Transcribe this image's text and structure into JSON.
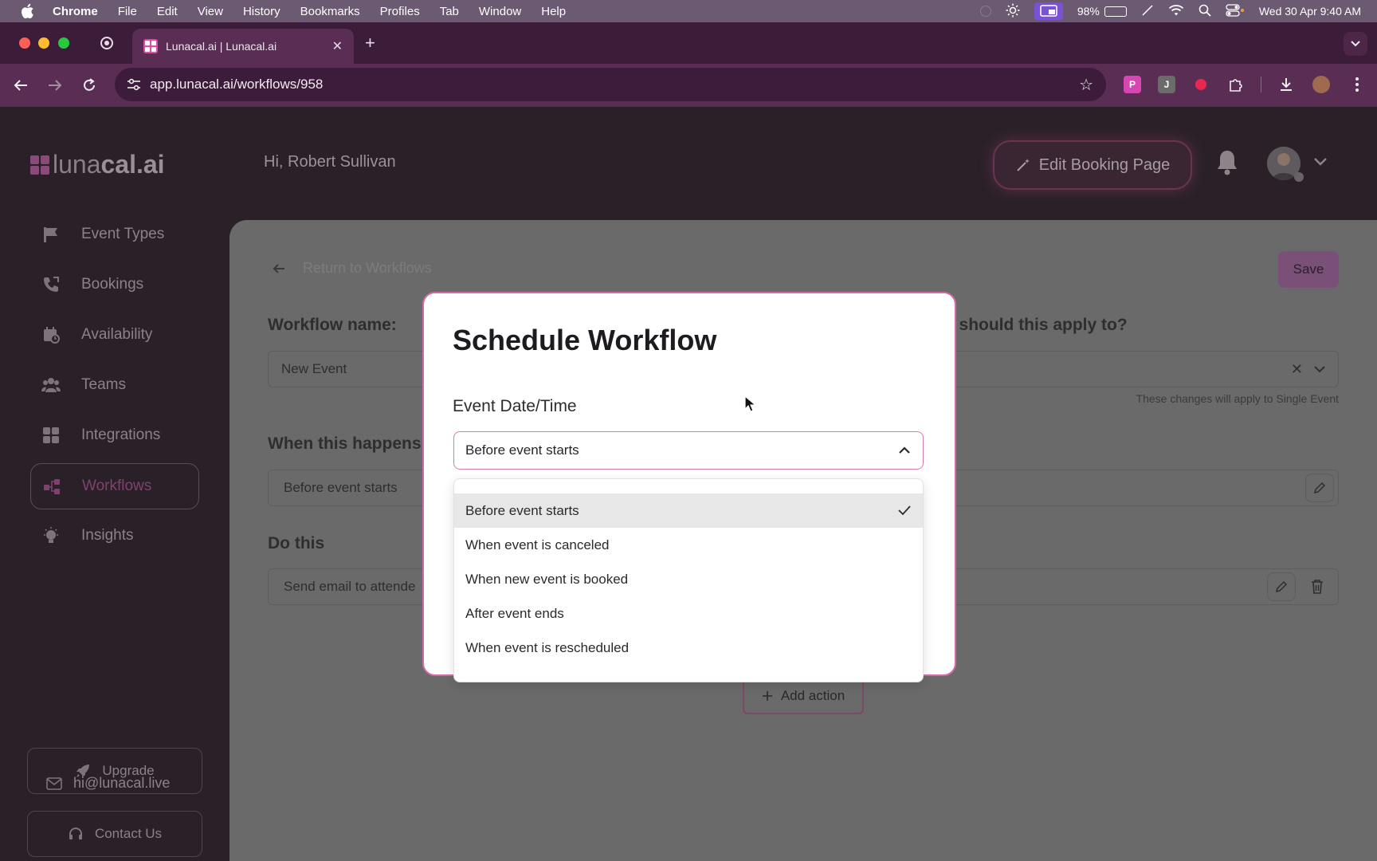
{
  "menubar": {
    "items": [
      "Chrome",
      "File",
      "Edit",
      "View",
      "History",
      "Bookmarks",
      "Profiles",
      "Tab",
      "Window",
      "Help"
    ],
    "battery": "98%",
    "battery_level": 0.98,
    "datetime": "Wed 30 Apr  9:40 AM"
  },
  "browser": {
    "tab_title": "Lunacal.ai | Lunacal.ai",
    "url": "app.lunacal.ai/workflows/958",
    "ext_j": "J"
  },
  "app": {
    "logo_light": "luna",
    "logo_bold": "cal.ai",
    "greeting": "Hi, Robert Sullivan",
    "edit_booking": "Edit Booking Page"
  },
  "sidebar": {
    "items": [
      {
        "label": "Event Types",
        "icon": "flag-icon"
      },
      {
        "label": "Bookings",
        "icon": "phone-icon"
      },
      {
        "label": "Availability",
        "icon": "calendar-clock-icon"
      },
      {
        "label": "Teams",
        "icon": "users-icon"
      },
      {
        "label": "Integrations",
        "icon": "grid-icon"
      },
      {
        "label": "Workflows",
        "icon": "workflow-icon",
        "active": true
      },
      {
        "label": "Insights",
        "icon": "lightbulb-icon"
      }
    ],
    "upgrade": "Upgrade",
    "contact": "Contact Us",
    "email": "hi@lunacal.live"
  },
  "workflow": {
    "back_label": "Return to Workflows",
    "save": "Save",
    "name_label": "Workflow name:",
    "name_value": "New Event",
    "apply_label": "e should this apply to?",
    "apply_hint": "These changes will apply to Single Event",
    "trigger_label": "When this happens",
    "trigger_value": "Before event starts",
    "action_label": "Do this",
    "action_value": "Send email to attende",
    "add_action": "Add action"
  },
  "modal": {
    "title": "Schedule Workflow",
    "field_label": "Event Date/Time",
    "selected": "Before event starts",
    "options": [
      "Before event starts",
      "When event is canceled",
      "When new event is booked",
      "After event ends",
      "When event is rescheduled"
    ]
  }
}
